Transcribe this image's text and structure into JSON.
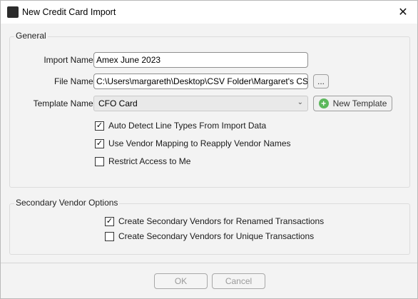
{
  "window": {
    "title": "New Credit Card Import",
    "close_glyph": "✕"
  },
  "general": {
    "legend": "General",
    "import_name_label": "Import Name:",
    "import_name_value": "Amex June 2023",
    "file_name_label": "File Name:",
    "file_name_value": "C:\\Users\\margareth\\Desktop\\CSV Folder\\Margaret's CSV",
    "browse_label": "...",
    "template_name_label": "Template Name:",
    "template_name_value": "CFO Card",
    "new_template_label": "New Template",
    "checkboxes": [
      {
        "label": "Auto Detect Line Types From Import Data",
        "checked": true
      },
      {
        "label": "Use Vendor Mapping to Reapply Vendor Names",
        "checked": true
      },
      {
        "label": "Restrict Access to Me",
        "checked": false
      }
    ]
  },
  "secondary": {
    "legend": "Secondary Vendor Options",
    "checkboxes": [
      {
        "label": "Create Secondary Vendors for Renamed Transactions",
        "checked": true
      },
      {
        "label": "Create Secondary Vendors for Unique Transactions",
        "checked": false
      }
    ]
  },
  "footer": {
    "ok_label": "OK",
    "cancel_label": "Cancel"
  },
  "icons": {
    "app": "app-icon",
    "dropdown": "chevron-down-icon",
    "new_template": "plus-circle-icon",
    "check_glyph": "✓"
  },
  "colors": {
    "accent_green": "#5cb85c",
    "window_bg": "#f3f3f3"
  }
}
